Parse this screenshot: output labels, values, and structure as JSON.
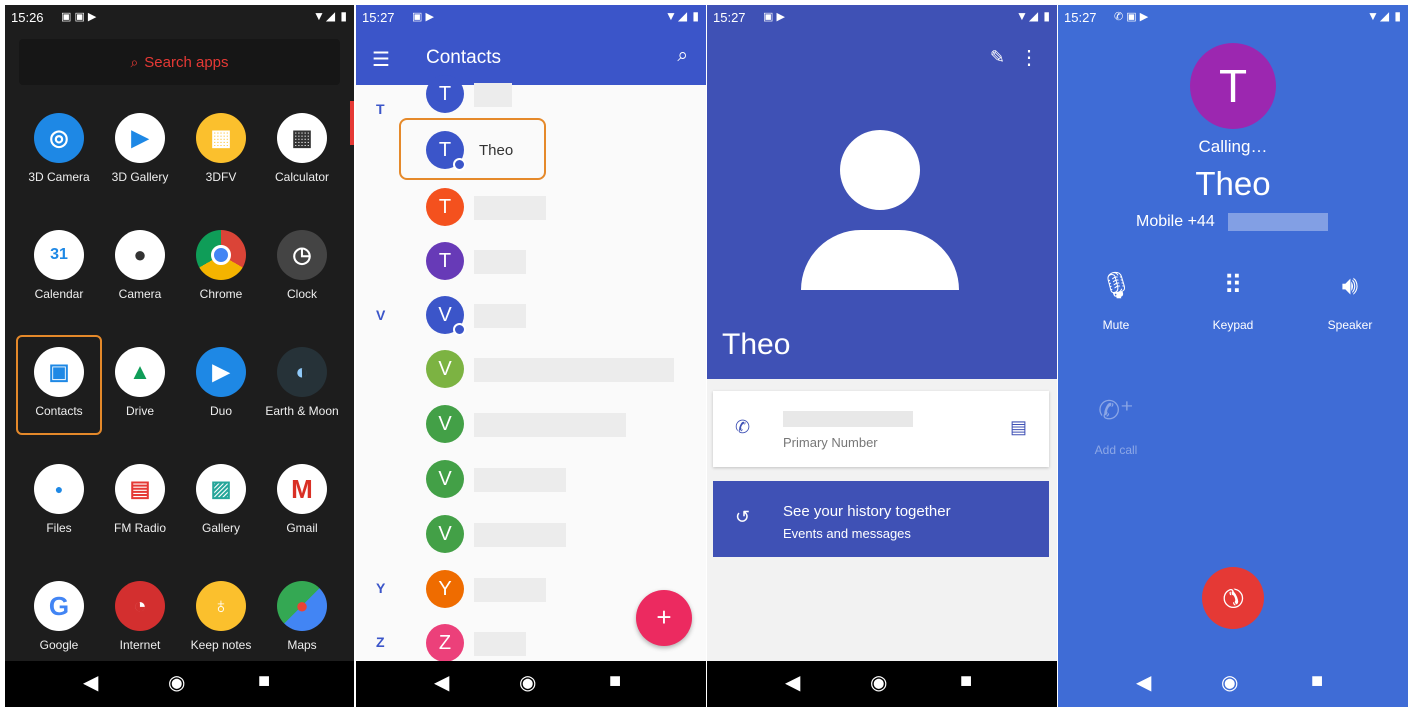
{
  "launcher": {
    "status_time": "15:26",
    "search_placeholder": "Search apps",
    "apps": [
      {
        "label": "3D Camera"
      },
      {
        "label": "3D Gallery"
      },
      {
        "label": "3DFV"
      },
      {
        "label": "Calculator"
      },
      {
        "label": "Calendar"
      },
      {
        "label": "Camera"
      },
      {
        "label": "Chrome"
      },
      {
        "label": "Clock"
      },
      {
        "label": "Contacts"
      },
      {
        "label": "Drive"
      },
      {
        "label": "Duo"
      },
      {
        "label": "Earth & Moon"
      },
      {
        "label": "Files"
      },
      {
        "label": "FM Radio"
      },
      {
        "label": "Gallery"
      },
      {
        "label": "Gmail"
      },
      {
        "label": "Google"
      },
      {
        "label": "Internet"
      },
      {
        "label": "Keep notes"
      },
      {
        "label": "Maps"
      }
    ],
    "calendar_day": "31"
  },
  "contacts": {
    "status_time": "15:27",
    "title": "Contacts",
    "sections": [
      "T",
      "V",
      "Y",
      "Z"
    ],
    "selected_contact": "Theo",
    "avatars": [
      "T",
      "T",
      "T",
      "T",
      "V",
      "V",
      "V",
      "V",
      "V",
      "Y",
      "Z"
    ],
    "avatar_colors": [
      "#3b55c9",
      "#3b55c9",
      "#f4511e",
      "#673ab7",
      "#3b55c9",
      "#7cb342",
      "#43a047",
      "#43a047",
      "#43a047",
      "#ef6c00",
      "#ec407a"
    ],
    "fab_label": "+"
  },
  "detail": {
    "status_time": "15:27",
    "name": "Theo",
    "primary_label": "Primary Number",
    "history_title": "See your history together",
    "history_sub": "Events and messages"
  },
  "call": {
    "status_time": "15:27",
    "avatar_letter": "T",
    "status": "Calling…",
    "name": "Theo",
    "line_prefix": "Mobile +44",
    "buttons": {
      "mute": "Mute",
      "keypad": "Keypad",
      "speaker": "Speaker",
      "add_call": "Add call"
    }
  },
  "colors": {
    "accent_orange": "#e5892a",
    "contacts_blue": "#3b55c9",
    "detail_blue": "#3f51b5",
    "call_bg": "#3f6cd6",
    "end_call_red": "#e53935"
  }
}
